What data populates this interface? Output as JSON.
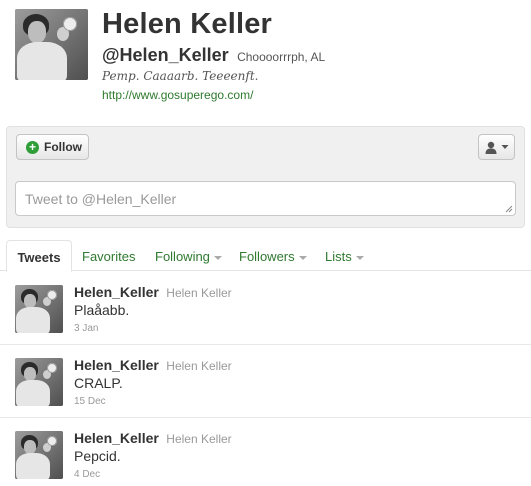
{
  "profile": {
    "name": "Helen Keller",
    "handle": "@Helen_Keller",
    "location": "Choooorrrph, AL",
    "bio": "Pemp. Caaaarb. Teeeenft.",
    "url": "http://www.gosuperego.com/"
  },
  "actions": {
    "follow_label": "Follow",
    "tweet_placeholder": "Tweet to @Helen_Keller"
  },
  "tabs": [
    {
      "label": "Tweets"
    },
    {
      "label": "Favorites"
    },
    {
      "label": "Following"
    },
    {
      "label": "Followers"
    },
    {
      "label": "Lists"
    }
  ],
  "tweets": [
    {
      "screen_name": "Helen_Keller",
      "full_name": "Helen Keller",
      "text": "Plaåabb.",
      "time": "3 Jan"
    },
    {
      "screen_name": "Helen_Keller",
      "full_name": "Helen Keller",
      "text": "CRALP.",
      "time": "15 Dec"
    },
    {
      "screen_name": "Helen_Keller",
      "full_name": "Helen Keller",
      "text": "Pepcid.",
      "time": "4 Dec"
    }
  ],
  "colors": {
    "link": "#2f7a2f",
    "follow_icon": "#2f9e38",
    "panel_bg": "#f0f0f0"
  },
  "icons": {
    "follow": "plus-circle-icon",
    "user_menu": "person-icon",
    "user_menu_caret": "caret-down-icon",
    "tab_caret": "caret-down-icon"
  }
}
